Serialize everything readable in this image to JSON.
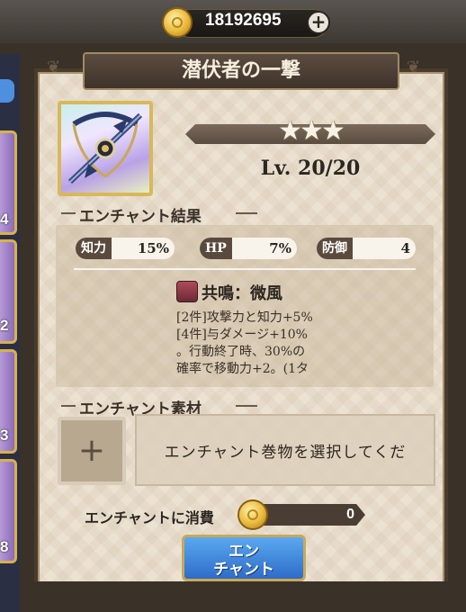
{
  "currency": {
    "coins": "18192695",
    "add_label": "+",
    "icon": "gold-coin-icon"
  },
  "side_list": {
    "numbers": [
      "4",
      "2",
      "3",
      "8"
    ]
  },
  "item": {
    "name": "潜伏者の一撃",
    "stars": "★★★",
    "level": "Lv. 20/20",
    "icon": "crossbow-icon"
  },
  "enchant_result": {
    "header": "エンチャント結果",
    "stats": [
      {
        "label": "知力",
        "value": "15%"
      },
      {
        "label": "HP",
        "value": "7%"
      },
      {
        "label": "防御",
        "value": "4"
      }
    ],
    "set_name": "共鳴：微風",
    "set_desc_1": "[2件]攻撃力と知力+5%",
    "set_desc_2": "[4件]与ダメージ+10%",
    "set_desc_3": "。行動終了時、30%の",
    "set_desc_4": "確率で移動力+2。(1タ"
  },
  "materials": {
    "header": "エンチャント素材",
    "add_slot": "+",
    "placeholder": "エンチャント巻物を選択してくだ"
  },
  "cost": {
    "label": "エンチャントに消費",
    "value": "0"
  },
  "button": {
    "line1": "エン",
    "line2": "チャント"
  }
}
